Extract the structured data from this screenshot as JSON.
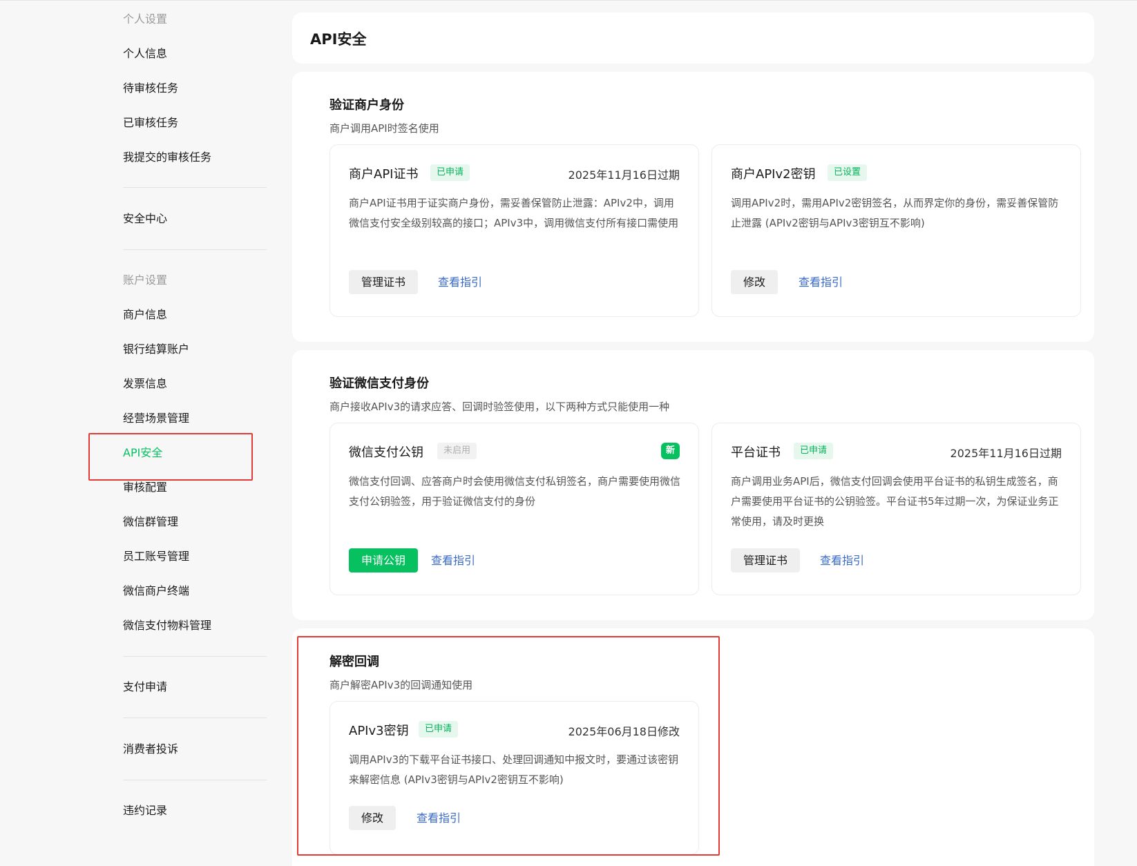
{
  "sidebar": {
    "group_personal": "个人设置",
    "personal_info": "个人信息",
    "pending_tasks": "待审核任务",
    "reviewed_tasks": "已审核任务",
    "submitted_tasks": "我提交的审核任务",
    "security_center": "安全中心",
    "group_account": "账户设置",
    "merchant_info": "商户信息",
    "bank_account": "银行结算账户",
    "invoice_info": "发票信息",
    "scene_mgmt": "经营场景管理",
    "api_security": "API安全",
    "review_config": "审核配置",
    "wechat_group_mgmt": "微信群管理",
    "staff_account_mgmt": "员工账号管理",
    "merchant_terminal": "微信商户终端",
    "material_mgmt": "微信支付物料管理",
    "pay_apply": "支付申请",
    "complaints": "消费者投诉",
    "violations": "违约记录"
  },
  "page": {
    "title": "API安全"
  },
  "verify_merchant": {
    "title": "验证商户身份",
    "desc": "商户调用API时签名使用",
    "api_cert": {
      "title": "商户API证书",
      "badge": "已申请",
      "meta": "2025年11月16日过期",
      "desc": "商户API证书用于证实商户身份，需妥善保管防止泄露：APIv2中，调用微信支付安全级别较高的接口；APIv3中，调用微信支付所有接口需使用",
      "btn": "管理证书",
      "link": "查看指引"
    },
    "apiv2_key": {
      "title": "商户APIv2密钥",
      "badge": "已设置",
      "desc": "调用APIv2时，需用APIv2密钥签名，从而界定你的身份，需妥善保管防止泄露 (APIv2密钥与APIv3密钥互不影响)",
      "btn": "修改",
      "link": "查看指引"
    }
  },
  "verify_wechat": {
    "title": "验证微信支付身份",
    "desc": "商户接收APIv3的请求应答、回调时验签使用，以下两种方式只能使用一种",
    "public_key": {
      "title": "微信支付公钥",
      "badge": "未启用",
      "new_badge": "新",
      "desc": "微信支付回调、应答商户时会使用微信支付私钥签名，商户需要使用微信支付公钥验签，用于验证微信支付的身份",
      "btn": "申请公钥",
      "link": "查看指引"
    },
    "platform_cert": {
      "title": "平台证书",
      "badge": "已申请",
      "meta": "2025年11月16日过期",
      "desc": "商户调用业务API后，微信支付回调会使用平台证书的私钥生成签名，商户需要使用平台证书的公钥验签。平台证书5年过期一次，为保证业务正常使用，请及时更换",
      "btn": "管理证书",
      "link": "查看指引"
    }
  },
  "decrypt_callback": {
    "title": "解密回调",
    "desc": "商户解密APIv3的回调通知使用",
    "apiv3_key": {
      "title": "APIv3密钥",
      "badge": "已申请",
      "meta": "2025年06月18日修改",
      "desc": "调用APIv3的下载平台证书接口、处理回调通知中报文时，要通过该密钥来解密信息 (APIv3密钥与APIv2密钥互不影响)",
      "btn": "修改",
      "link": "查看指引"
    }
  },
  "colors": {
    "brand_green": "#07c160",
    "link_blue": "#3a6ac8",
    "highlight_red": "#e53935"
  }
}
